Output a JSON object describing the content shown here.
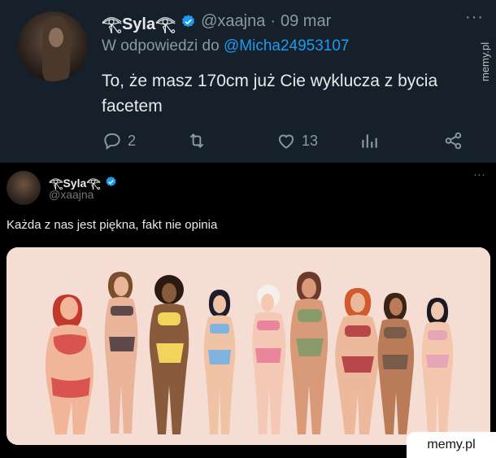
{
  "reply_tweet": {
    "display_name": "𓂀Syla𓂀",
    "handle": "@xaajna",
    "separator": "·",
    "date": "09 mar",
    "reply_prefix": "W odpowiedzi do",
    "reply_mention": "@Micha24953107",
    "text": "To, że masz 170cm już Cie wyklucza z bycia facetem",
    "more": "···",
    "actions": {
      "replies": "2",
      "retweets": "",
      "likes": "13",
      "views": "",
      "share": ""
    }
  },
  "quoted_tweet": {
    "display_name": "𓂀Syla𓂀",
    "handle": "@xaajna",
    "more": "···",
    "text": "Każda z nas jest piękna, fakt nie opinia"
  },
  "watermark_side": "memy.pl",
  "watermark_badge": "memy.pl",
  "colors": {
    "dim_bg": "#15202b",
    "black_bg": "#000000",
    "accent": "#1d9bf0",
    "muted": "#8b98a5",
    "media_bg": "#f6ddd3"
  },
  "icons": [
    "reply-icon",
    "retweet-icon",
    "like-icon",
    "views-icon",
    "share-icon",
    "verified-icon"
  ]
}
